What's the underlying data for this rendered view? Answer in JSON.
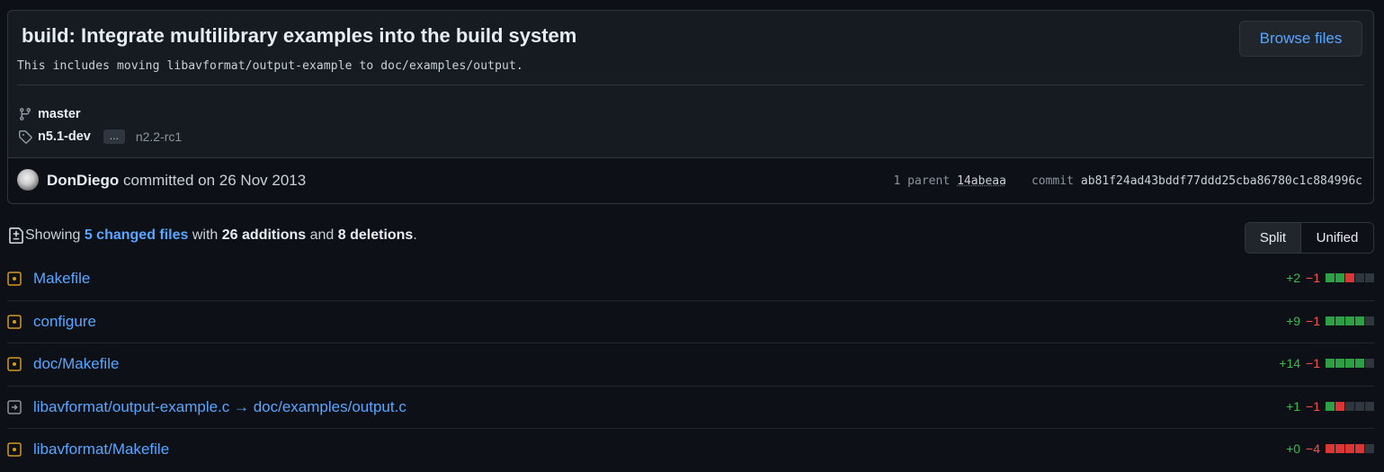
{
  "commit": {
    "title": "build: Integrate multilibrary examples into the build system",
    "description": "This includes moving libavformat/output-example to doc/examples/output.",
    "browse_label": "Browse files",
    "branch": "master",
    "tag_primary": "n5.1-dev",
    "tag_more": "…",
    "tag_last": "n2.2-rc1",
    "author": "DonDiego",
    "committed_text": "committed on 26 Nov 2013",
    "parent_label": "1 parent",
    "parent_sha": "14abeaa",
    "commit_label": "commit",
    "commit_sha": "ab81f24ad43bddf77ddd25cba86780c1c884996c"
  },
  "summary": {
    "showing": "Showing",
    "changed_link": "5 changed files",
    "with": "with",
    "additions": "26 additions",
    "and": "and",
    "deletions": "8 deletions",
    "period": "."
  },
  "view_toggle": {
    "split": "Split",
    "unified": "Unified"
  },
  "colors": {
    "accent": "#58a6ff",
    "add": "#3fb950",
    "del": "#f85149",
    "modified_icon": "#d29922"
  },
  "files": [
    {
      "name": "Makefile",
      "status_icon": "file-diff-modified-icon",
      "add": "+2",
      "del": "−1",
      "blocks": [
        "add",
        "add",
        "del",
        "neu",
        "neu"
      ]
    },
    {
      "name": "configure",
      "status_icon": "file-diff-modified-icon",
      "add": "+9",
      "del": "−1",
      "blocks": [
        "add",
        "add",
        "add",
        "add",
        "neu"
      ]
    },
    {
      "name": "doc/Makefile",
      "status_icon": "file-diff-modified-icon",
      "add": "+14",
      "del": "−1",
      "blocks": [
        "add",
        "add",
        "add",
        "add",
        "neu"
      ]
    },
    {
      "name": "libavformat/output-example.c → doc/examples/output.c",
      "status_icon": "file-diff-renamed-icon",
      "add": "+1",
      "del": "−1",
      "blocks": [
        "add",
        "del",
        "neu",
        "neu",
        "neu"
      ]
    },
    {
      "name": "libavformat/Makefile",
      "status_icon": "file-diff-modified-icon",
      "add": "+0",
      "del": "−4",
      "blocks": [
        "del",
        "del",
        "del",
        "del",
        "neu"
      ]
    }
  ]
}
